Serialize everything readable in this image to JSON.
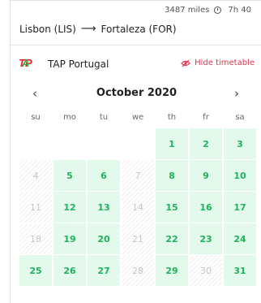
{
  "flight": {
    "distance": "3487 miles",
    "duration": "7h 40",
    "origin": "Lisbon (LIS)",
    "destination": "Fortaleza (FOR)"
  },
  "airline": {
    "logo_text": "TAP",
    "name": "TAP Portugal",
    "hide_timetable_label": "Hide timetable"
  },
  "calendar": {
    "month": "October 2020",
    "weekdays": [
      "su",
      "mo",
      "tu",
      "we",
      "th",
      "fr",
      "sa"
    ],
    "leading_blanks": 4,
    "days": [
      {
        "d": "1",
        "a": true
      },
      {
        "d": "2",
        "a": true
      },
      {
        "d": "3",
        "a": true
      },
      {
        "d": "4",
        "a": false
      },
      {
        "d": "5",
        "a": true
      },
      {
        "d": "6",
        "a": true
      },
      {
        "d": "7",
        "a": false
      },
      {
        "d": "8",
        "a": true
      },
      {
        "d": "9",
        "a": true
      },
      {
        "d": "10",
        "a": true
      },
      {
        "d": "11",
        "a": false
      },
      {
        "d": "12",
        "a": true
      },
      {
        "d": "13",
        "a": true
      },
      {
        "d": "14",
        "a": false
      },
      {
        "d": "15",
        "a": true
      },
      {
        "d": "16",
        "a": true
      },
      {
        "d": "17",
        "a": true
      },
      {
        "d": "18",
        "a": false
      },
      {
        "d": "19",
        "a": true
      },
      {
        "d": "20",
        "a": true
      },
      {
        "d": "21",
        "a": false
      },
      {
        "d": "22",
        "a": true
      },
      {
        "d": "23",
        "a": true
      },
      {
        "d": "24",
        "a": true
      },
      {
        "d": "25",
        "a": true
      },
      {
        "d": "26",
        "a": true
      },
      {
        "d": "27",
        "a": true
      },
      {
        "d": "28",
        "a": false
      },
      {
        "d": "29",
        "a": true
      },
      {
        "d": "30",
        "a": false
      },
      {
        "d": "31",
        "a": true
      }
    ]
  },
  "colors": {
    "available_bg": "#e2f9ec",
    "available_text": "#1fb35c",
    "accent_red": "#e0324b"
  }
}
